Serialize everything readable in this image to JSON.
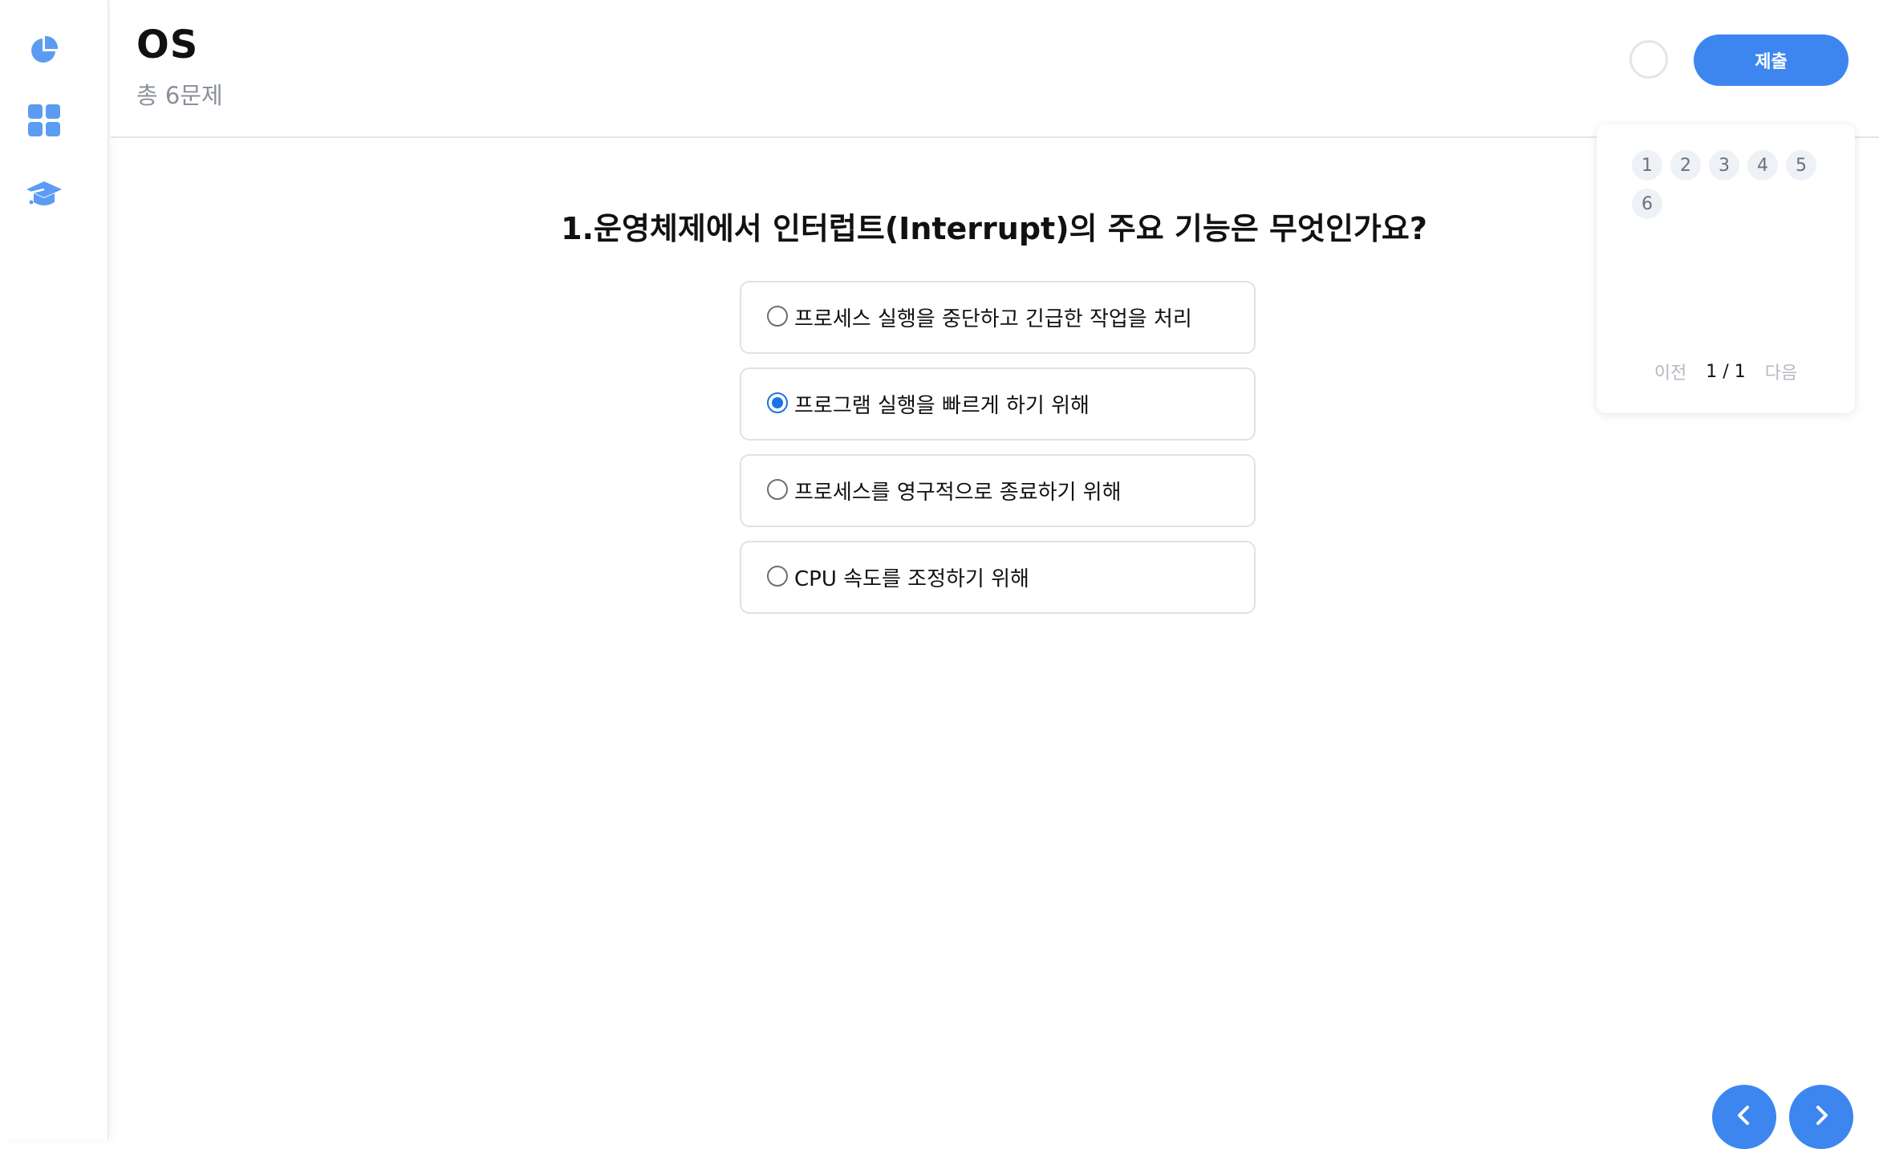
{
  "header": {
    "title": "OS",
    "subtitle": "총 6문제",
    "submit_label": "제출"
  },
  "sidebar": {
    "items": [
      {
        "icon": "pie-chart-icon"
      },
      {
        "icon": "grid-icon"
      },
      {
        "icon": "graduation-cap-icon"
      }
    ]
  },
  "question": {
    "title": "1.운영체제에서 인터럽트(Interrupt)의 주요 기능은 무엇인가요?",
    "options": [
      {
        "label": "프로세스 실행을 중단하고 긴급한 작업을 처리",
        "selected": false
      },
      {
        "label": "프로그램 실행을 빠르게 하기 위해",
        "selected": true
      },
      {
        "label": "프로세스를 영구적으로 종료하기 위해",
        "selected": false
      },
      {
        "label": "CPU 속도를 조정하기 위해",
        "selected": false
      }
    ]
  },
  "navigator": {
    "numbers": [
      "1",
      "2",
      "3",
      "4",
      "5",
      "6"
    ],
    "prev_label": "이전",
    "page_count": "1 / 1",
    "next_label": "다음"
  },
  "colors": {
    "accent": "#3d86f0",
    "radio_checked": "#1a73e8"
  }
}
